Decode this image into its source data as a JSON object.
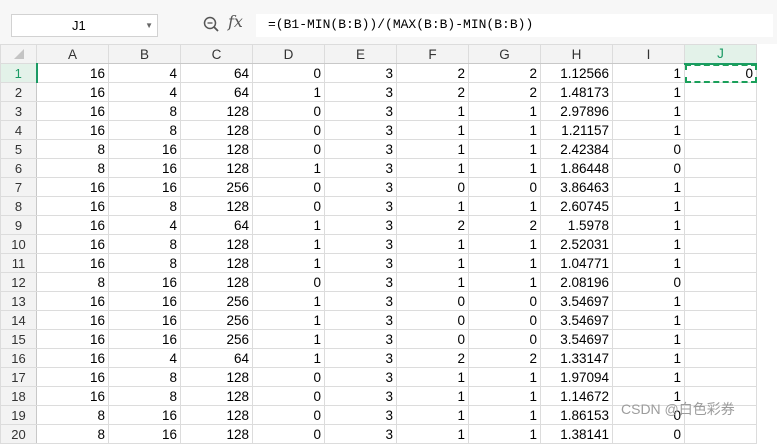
{
  "formula_bar": {
    "name_box": "J1",
    "fx_label": "fx",
    "formula": "=(B1-MIN(B:B))/(MAX(B:B)-MIN(B:B))"
  },
  "columns": [
    "A",
    "B",
    "C",
    "D",
    "E",
    "F",
    "G",
    "H",
    "I",
    "J"
  ],
  "active_cell": {
    "row": 1,
    "column": "J"
  },
  "rows": [
    {
      "n": "1",
      "cells": [
        "16",
        "4",
        "64",
        "0",
        "3",
        "2",
        "2",
        "1.12566",
        "1",
        "0"
      ]
    },
    {
      "n": "2",
      "cells": [
        "16",
        "4",
        "64",
        "1",
        "3",
        "2",
        "2",
        "1.48173",
        "1",
        ""
      ]
    },
    {
      "n": "3",
      "cells": [
        "16",
        "8",
        "128",
        "0",
        "3",
        "1",
        "1",
        "2.97896",
        "1",
        ""
      ]
    },
    {
      "n": "4",
      "cells": [
        "16",
        "8",
        "128",
        "0",
        "3",
        "1",
        "1",
        "1.21157",
        "1",
        ""
      ]
    },
    {
      "n": "5",
      "cells": [
        "8",
        "16",
        "128",
        "0",
        "3",
        "1",
        "1",
        "2.42384",
        "0",
        ""
      ]
    },
    {
      "n": "6",
      "cells": [
        "8",
        "16",
        "128",
        "1",
        "3",
        "1",
        "1",
        "1.86448",
        "0",
        ""
      ]
    },
    {
      "n": "7",
      "cells": [
        "16",
        "16",
        "256",
        "0",
        "3",
        "0",
        "0",
        "3.86463",
        "1",
        ""
      ]
    },
    {
      "n": "8",
      "cells": [
        "16",
        "8",
        "128",
        "0",
        "3",
        "1",
        "1",
        "2.60745",
        "1",
        ""
      ]
    },
    {
      "n": "9",
      "cells": [
        "16",
        "4",
        "64",
        "1",
        "3",
        "2",
        "2",
        "1.5978",
        "1",
        ""
      ]
    },
    {
      "n": "10",
      "cells": [
        "16",
        "8",
        "128",
        "1",
        "3",
        "1",
        "1",
        "2.52031",
        "1",
        ""
      ]
    },
    {
      "n": "11",
      "cells": [
        "16",
        "8",
        "128",
        "1",
        "3",
        "1",
        "1",
        "1.04771",
        "1",
        ""
      ]
    },
    {
      "n": "12",
      "cells": [
        "8",
        "16",
        "128",
        "0",
        "3",
        "1",
        "1",
        "2.08196",
        "0",
        ""
      ]
    },
    {
      "n": "13",
      "cells": [
        "16",
        "16",
        "256",
        "1",
        "3",
        "0",
        "0",
        "3.54697",
        "1",
        ""
      ]
    },
    {
      "n": "14",
      "cells": [
        "16",
        "16",
        "256",
        "1",
        "3",
        "0",
        "0",
        "3.54697",
        "1",
        ""
      ]
    },
    {
      "n": "15",
      "cells": [
        "16",
        "16",
        "256",
        "1",
        "3",
        "0",
        "0",
        "3.54697",
        "1",
        ""
      ]
    },
    {
      "n": "16",
      "cells": [
        "16",
        "4",
        "64",
        "1",
        "3",
        "2",
        "2",
        "1.33147",
        "1",
        ""
      ]
    },
    {
      "n": "17",
      "cells": [
        "16",
        "8",
        "128",
        "0",
        "3",
        "1",
        "1",
        "1.97094",
        "1",
        ""
      ]
    },
    {
      "n": "18",
      "cells": [
        "16",
        "8",
        "128",
        "0",
        "3",
        "1",
        "1",
        "1.14672",
        "1",
        ""
      ]
    },
    {
      "n": "19",
      "cells": [
        "8",
        "16",
        "128",
        "0",
        "3",
        "1",
        "1",
        "1.86153",
        "0",
        ""
      ]
    },
    {
      "n": "20",
      "cells": [
        "8",
        "16",
        "128",
        "0",
        "3",
        "1",
        "1",
        "1.38141",
        "0",
        ""
      ]
    }
  ],
  "watermark": "CSDN @白色彩券"
}
